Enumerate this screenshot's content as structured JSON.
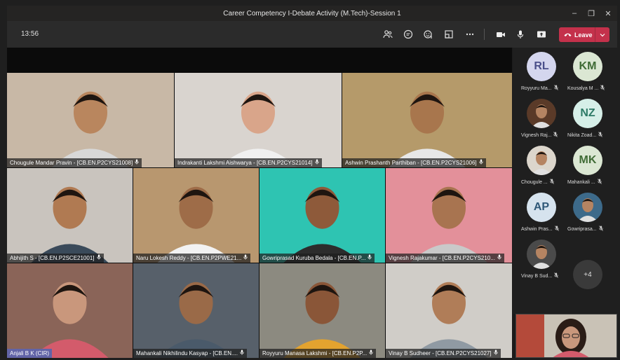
{
  "window": {
    "title": "Career Competency I-Debate Activity (M.Tech)-Session 1"
  },
  "toolbar": {
    "time": "13:56",
    "leave_label": "Leave"
  },
  "grid": [
    {
      "name": "Chougule Mandar Pravin - [CB.EN.P2CYS21008]",
      "bg": "#c8b8a6",
      "hl": false
    },
    {
      "name": "Indrakanti Lakshmi Aishwarya - [CB.EN.P2CYS21014]",
      "bg": "#d9d4cf",
      "hl": false
    },
    {
      "name": "Ashwin Prashanth Parthiban - [CB.EN.P2CYS21006]",
      "bg": "#b59a6a",
      "hl": false
    },
    {
      "name": "Abhijith S - [CB.EN.P2SCE21001]",
      "bg": "#c9c4be",
      "hl": false
    },
    {
      "name": "Naru Lokesh Reddy - [CB.EN.P2PWE21...",
      "bg": "#b8976f",
      "hl": false
    },
    {
      "name": "Gowriprasad Kuruba Bedala - [CB.EN.P...",
      "bg": "#2ec4b2",
      "hl": false
    },
    {
      "name": "Vignesh Rajakumar - [CB.EN.P2CYS210...",
      "bg": "#e3909a",
      "hl": false
    },
    {
      "name": "Anjali B K (CIR)",
      "bg": "#8a6458",
      "hl": true
    },
    {
      "name": "Mahankali Nikhilindu Kasyap - [CB.EN....",
      "bg": "#57606a",
      "hl": false
    },
    {
      "name": "Royyuru Manasa Lakshmi - [CB.EN.P2P...",
      "bg": "#8c8a80",
      "hl": false
    },
    {
      "name": "Vinay B Sudheer - [CB.EN.P2CYS21027]",
      "bg": "#d0cdc8",
      "hl": false
    }
  ],
  "participants": [
    {
      "initials": "RL",
      "name": "Royyuru Ma...",
      "avatar_bg": "#d4d6ee",
      "avatar_fg": "#4a4f8a"
    },
    {
      "initials": "KM",
      "name": "Kousalya M ...",
      "avatar_bg": "#dbe7d3",
      "avatar_fg": "#3f6b35"
    },
    {
      "initials": "",
      "name": "Vignesh Raj...",
      "avatar_bg": "#5a3a28",
      "avatar_fg": "#ffffff"
    },
    {
      "initials": "NZ",
      "name": "Nikita Zoad...",
      "avatar_bg": "#d6efe8",
      "avatar_fg": "#2d7a66"
    },
    {
      "initials": "",
      "name": "Chougule ...",
      "avatar_bg": "#dcd6cc",
      "avatar_fg": "#ffffff"
    },
    {
      "initials": "MK",
      "name": "Mahankali ...",
      "avatar_bg": "#dbe7d3",
      "avatar_fg": "#3f6b35"
    },
    {
      "initials": "AP",
      "name": "Ashwin Pras...",
      "avatar_bg": "#d6e3ee",
      "avatar_fg": "#2f5878"
    },
    {
      "initials": "",
      "name": "Gowriprasa...",
      "avatar_bg": "#3d6a8a",
      "avatar_fg": "#ffffff"
    },
    {
      "initials": "",
      "name": "Vinay B Sud...",
      "avatar_bg": "#4a4a4a",
      "avatar_fg": "#ffffff"
    }
  ],
  "overflow_count": "+4",
  "colors": {
    "leave": "#c4314b",
    "highlight": "#6264a7"
  }
}
